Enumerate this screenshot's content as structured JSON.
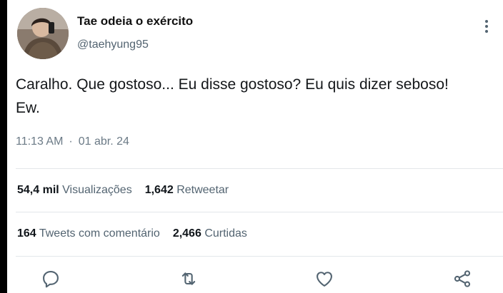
{
  "author": {
    "display_name": "Tae odeia o exército",
    "handle": "@taehyung95"
  },
  "tweet": {
    "text": "Caralho. Que gostoso... Eu disse gostoso? Eu quis dizer seboso!\nEw.",
    "time": "11:13 AM",
    "date": "01 abr. 24"
  },
  "stats": {
    "views_count": "54,4 mil",
    "views_label": "Visualizações",
    "retweets_count": "1,642",
    "retweets_label": "Retweetar",
    "quotes_count": "164",
    "quotes_label": "Tweets com comentário",
    "likes_count": "2,466",
    "likes_label": "Curtidas"
  },
  "icons": {
    "reply": "reply-icon",
    "retweet": "retweet-icon",
    "like": "heart-icon",
    "share": "share-icon",
    "more": "more-vertical-icon"
  },
  "colors": {
    "icon_gray": "#536471",
    "text_dark": "#0f1419",
    "divider": "#e3e7ea"
  }
}
